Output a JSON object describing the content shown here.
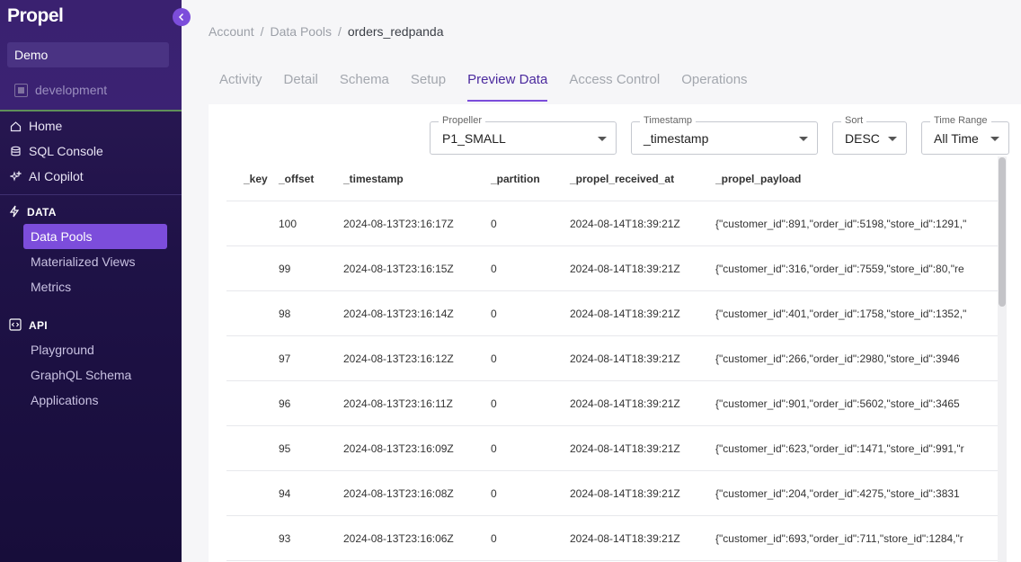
{
  "sidebar": {
    "logo": "Propel",
    "org": "Demo",
    "environment": "development",
    "nav": [
      {
        "label": "Home",
        "icon": "home-icon"
      },
      {
        "label": "SQL Console",
        "icon": "database-icon"
      },
      {
        "label": "AI Copilot",
        "icon": "sparkle-icon"
      }
    ],
    "data_section": {
      "title": "DATA",
      "items": [
        {
          "label": "Data Pools",
          "active": true
        },
        {
          "label": "Materialized Views",
          "active": false
        },
        {
          "label": "Metrics",
          "active": false
        }
      ]
    },
    "api_section": {
      "title": "API",
      "items": [
        {
          "label": "Playground"
        },
        {
          "label": "GraphQL Schema"
        },
        {
          "label": "Applications"
        }
      ]
    }
  },
  "breadcrumb": [
    "Account",
    "Data Pools",
    "orders_redpanda"
  ],
  "tabs": [
    "Activity",
    "Detail",
    "Schema",
    "Setup",
    "Preview Data",
    "Access Control",
    "Operations"
  ],
  "active_tab": "Preview Data",
  "filters": {
    "propeller": {
      "label": "Propeller",
      "value": "P1_SMALL"
    },
    "timestamp": {
      "label": "Timestamp",
      "value": "_timestamp"
    },
    "sort": {
      "label": "Sort",
      "value": "DESC"
    },
    "time_range": {
      "label": "Time Range",
      "value": "All Time"
    }
  },
  "table": {
    "columns": [
      "_key",
      "_offset",
      "_timestamp",
      "_partition",
      "_propel_received_at",
      "_propel_payload"
    ],
    "rows": [
      [
        "",
        "100",
        "2024-08-13T23:16:17Z",
        "0",
        "2024-08-14T18:39:21Z",
        "{\"customer_id\":891,\"order_id\":5198,\"store_id\":1291,\""
      ],
      [
        "",
        "99",
        "2024-08-13T23:16:15Z",
        "0",
        "2024-08-14T18:39:21Z",
        "{\"customer_id\":316,\"order_id\":7559,\"store_id\":80,\"re"
      ],
      [
        "",
        "98",
        "2024-08-13T23:16:14Z",
        "0",
        "2024-08-14T18:39:21Z",
        "{\"customer_id\":401,\"order_id\":1758,\"store_id\":1352,\""
      ],
      [
        "",
        "97",
        "2024-08-13T23:16:12Z",
        "0",
        "2024-08-14T18:39:21Z",
        "{\"customer_id\":266,\"order_id\":2980,\"store_id\":3946"
      ],
      [
        "",
        "96",
        "2024-08-13T23:16:11Z",
        "0",
        "2024-08-14T18:39:21Z",
        "{\"customer_id\":901,\"order_id\":5602,\"store_id\":3465"
      ],
      [
        "",
        "95",
        "2024-08-13T23:16:09Z",
        "0",
        "2024-08-14T18:39:21Z",
        "{\"customer_id\":623,\"order_id\":1471,\"store_id\":991,\"r"
      ],
      [
        "",
        "94",
        "2024-08-13T23:16:08Z",
        "0",
        "2024-08-14T18:39:21Z",
        "{\"customer_id\":204,\"order_id\":4275,\"store_id\":3831"
      ],
      [
        "",
        "93",
        "2024-08-13T23:16:06Z",
        "0",
        "2024-08-14T18:39:21Z",
        "{\"customer_id\":693,\"order_id\":711,\"store_id\":1284,\"r"
      ]
    ]
  },
  "colors": {
    "accent": "#7c4ddb",
    "sidebar_bg": "#1f1247",
    "active_tab": "#4b2a9e"
  }
}
